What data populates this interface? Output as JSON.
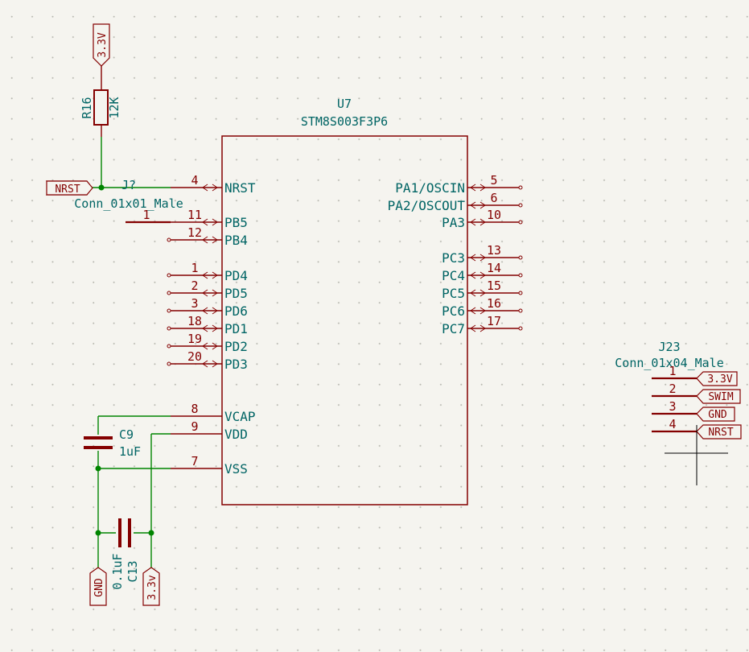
{
  "u7": {
    "ref": "U7",
    "value": "STM8S003F3P6",
    "left_pins": [
      {
        "name": "NRST",
        "num": "4"
      },
      {
        "name": "PB5",
        "num": "11"
      },
      {
        "name": "PB4",
        "num": "12"
      },
      {
        "name": "PD4",
        "num": "1"
      },
      {
        "name": "PD5",
        "num": "2"
      },
      {
        "name": "PD6",
        "num": "3"
      },
      {
        "name": "PD1",
        "num": "18"
      },
      {
        "name": "PD2",
        "num": "19"
      },
      {
        "name": "PD3",
        "num": "20"
      },
      {
        "name": "VCAP",
        "num": "8"
      },
      {
        "name": "VDD",
        "num": "9"
      },
      {
        "name": "VSS",
        "num": "7"
      }
    ],
    "right_pins": [
      {
        "name": "PA1/OSCIN",
        "num": "5"
      },
      {
        "name": "PA2/OSCOUT",
        "num": "6"
      },
      {
        "name": "PA3",
        "num": "10"
      },
      {
        "name": "PC3",
        "num": "13"
      },
      {
        "name": "PC4",
        "num": "14"
      },
      {
        "name": "PC5",
        "num": "15"
      },
      {
        "name": "PC6",
        "num": "16"
      },
      {
        "name": "PC7",
        "num": "17"
      }
    ]
  },
  "r16": {
    "ref": "R16",
    "value": "12K"
  },
  "c9": {
    "ref": "C9",
    "value": "1uF"
  },
  "c13": {
    "ref": "C13",
    "value": "0.1uF"
  },
  "j_nrst": {
    "ref": "J?",
    "value": "Conn_01x01_Male",
    "pin": "1"
  },
  "j23": {
    "ref": "J23",
    "value": "Conn_01x04_Male",
    "pins": [
      {
        "num": "1",
        "label": "3.3V"
      },
      {
        "num": "2",
        "label": "SWIM"
      },
      {
        "num": "3",
        "label": "GND"
      },
      {
        "num": "4",
        "label": "NRST"
      }
    ]
  },
  "net_labels": {
    "vcc_top": "3.3V",
    "nrst_left": "NRST",
    "gnd_bottom": "GND",
    "vcc_bottom": "3.3v"
  },
  "colors": {
    "symbol": "#840000",
    "wire": "#008400",
    "text": "#006464",
    "background": "#f5f4ef"
  }
}
